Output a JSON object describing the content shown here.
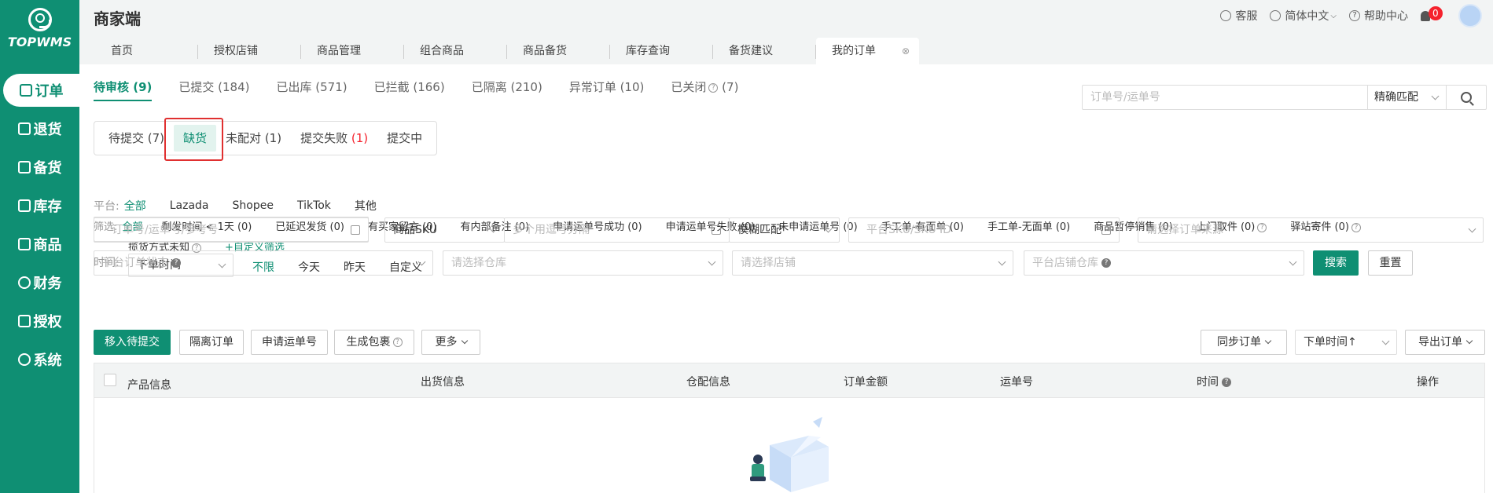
{
  "brand": {
    "logo_text": "TOPWMS"
  },
  "sidebar": {
    "items": [
      {
        "label": "订单",
        "icon": "order-icon",
        "active": true
      },
      {
        "label": "退货",
        "icon": "return-icon"
      },
      {
        "label": "备货",
        "icon": "stock-icon"
      },
      {
        "label": "库存",
        "icon": "inventory-icon"
      },
      {
        "label": "商品",
        "icon": "goods-icon"
      },
      {
        "label": "财务",
        "icon": "finance-icon"
      },
      {
        "label": "授权",
        "icon": "auth-icon"
      },
      {
        "label": "系统",
        "icon": "settings-icon"
      }
    ]
  },
  "header": {
    "title": "商家端",
    "service": "客服",
    "language": "简体中文",
    "help": "帮助中心",
    "notifications": "0"
  },
  "tabs": [
    {
      "label": "首页"
    },
    {
      "label": "授权店铺"
    },
    {
      "label": "商品管理"
    },
    {
      "label": "组合商品"
    },
    {
      "label": "商品备货"
    },
    {
      "label": "库存查询"
    },
    {
      "label": "备货建议"
    },
    {
      "label": "我的订单",
      "active": true
    }
  ],
  "status_tabs": [
    {
      "label": "待审核 (9)",
      "active": true
    },
    {
      "label": "已提交 (184)"
    },
    {
      "label": "已出库 (571)"
    },
    {
      "label": "已拦截 (166)"
    },
    {
      "label": "已隔离 (210)"
    },
    {
      "label": "异常订单 (10)"
    },
    {
      "label": "已关闭",
      "count": "(7)"
    }
  ],
  "top_search": {
    "placeholder": "订单号/运单号",
    "match": "精确匹配"
  },
  "sub_tabs": [
    {
      "label": "待提交 (7)"
    },
    {
      "label": "缺货",
      "active": true
    },
    {
      "label": "未配对 (1)"
    },
    {
      "label": "提交失败",
      "count": "(1)"
    },
    {
      "label": "提交中"
    }
  ],
  "platform": {
    "label": "平台:",
    "options": [
      "全部",
      "Lazada",
      "Shopee",
      "TikTok",
      "其他"
    ]
  },
  "filter": {
    "label": "筛选:",
    "options": [
      "全部",
      "剩发时间 < 1天 (0)",
      "已延迟发货 (0)",
      "有买家留言 (0)",
      "有内部备注 (0)",
      "申请运单号成功 (0)",
      "申请运单号失败 (0)",
      "未申请运单号 (0)",
      "手工单-有面单 (0)",
      "手工单-无面单 (0)",
      "商品暂停销售 (0)",
      "上门取件 (0)",
      "驿站寄件 (0)"
    ],
    "row2": [
      "揽货方式未知"
    ],
    "custom": "+自定义筛选"
  },
  "time": {
    "label": "时间:",
    "select": "下单时间",
    "options": [
      "不限",
      "今天",
      "昨天",
      "自定义"
    ]
  },
  "search_fields": {
    "order_no": "订单号/运单号/参考号",
    "sku_type": "商品SKU",
    "sku_multi": "多个用逗号分隔",
    "fuzzy": "模糊匹配",
    "platform_sku": "平台SKU/SKU ID",
    "order_source": "请选择订单来源",
    "platform_status": "平台订单状态",
    "warehouse": "请选择仓库",
    "store": "请选择店铺",
    "store_warehouse": "平台店铺仓库",
    "search_btn": "搜索",
    "reset_btn": "重置"
  },
  "actions": {
    "move": "移入待提交",
    "isolate": "隔离订单",
    "apply": "申请运单号",
    "package": "生成包裹",
    "more": "更多",
    "sync": "同步订单",
    "sort": "下单时间↑",
    "export": "导出订单"
  },
  "table": {
    "columns": [
      "产品信息",
      "出货信息",
      "仓配信息",
      "订单金额",
      "运单号",
      "时间",
      "操作"
    ]
  },
  "colors": {
    "primary": "#0f8f73",
    "danger": "#f5222d"
  }
}
